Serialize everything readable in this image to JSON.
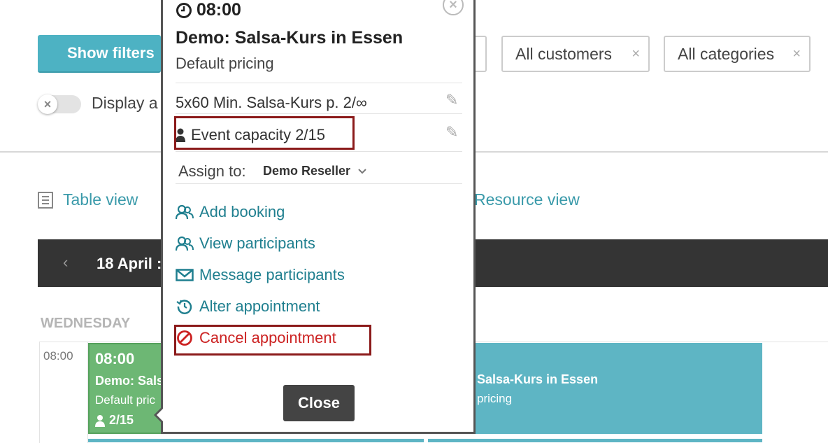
{
  "filters": {
    "show_filters_label": "Show filters",
    "customers_label": "All customers",
    "categories_label": "All categories",
    "remove_symbol": "×"
  },
  "toggle": {
    "label": "Display a",
    "knob_symbol": "×"
  },
  "views": {
    "table_view": "Table view",
    "resource_view": "Resource view"
  },
  "calendar": {
    "date_label": "18 April :",
    "prev_symbol": "‹",
    "day_label": "WEDNESDAY",
    "time_label": "08:00",
    "event_green": {
      "time": "08:00",
      "title": "Demo: Sals",
      "subtitle": "Default pric",
      "capacity": "2/15"
    },
    "event_blue": {
      "title": "Salsa-Kurs in Essen",
      "subtitle": "pricing"
    }
  },
  "popup": {
    "time": "08:00",
    "title": "Demo: Salsa-Kurs in Essen",
    "pricing": "Default pricing",
    "course": "5x60 Min. Salsa-Kurs p. 2/∞",
    "capacity": "Event capacity 2/15",
    "assign_label": "Assign to:",
    "assign_value": "Demo Reseller",
    "links": {
      "add_booking": "Add booking",
      "view_participants": "View participants",
      "message_participants": "Message participants",
      "alter_appointment": "Alter appointment",
      "cancel_appointment": "Cancel appointment"
    },
    "close_button": "Close"
  },
  "colors": {
    "accent": "#4db2c3",
    "link": "#1f7f8f",
    "danger": "#cc2222",
    "highlight_box": "#8b1a1a",
    "event_green": "#6db774",
    "event_blue": "#5eb5c4",
    "date_bar": "#343434"
  }
}
